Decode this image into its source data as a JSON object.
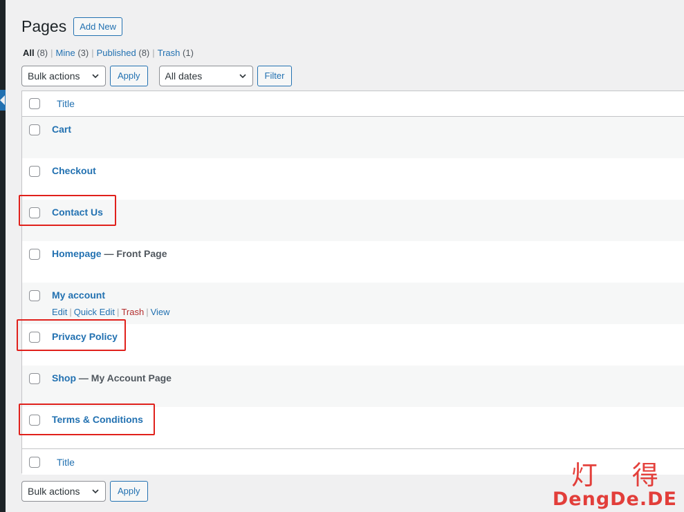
{
  "header": {
    "title": "Pages",
    "add_new_label": "Add New"
  },
  "views": [
    {
      "label": "All",
      "count": "(8)",
      "current": true
    },
    {
      "label": "Mine",
      "count": "(3)"
    },
    {
      "label": "Published",
      "count": "(8)"
    },
    {
      "label": "Trash",
      "count": "(1)"
    }
  ],
  "tablenav_top": {
    "bulk_actions": "Bulk actions",
    "apply_label": "Apply",
    "dates": "All dates",
    "filter_label": "Filter"
  },
  "tablenav_bottom": {
    "bulk_actions": "Bulk actions",
    "apply_label": "Apply"
  },
  "table": {
    "column_title": "Title",
    "rows": [
      {
        "title": "Cart",
        "state": ""
      },
      {
        "title": "Checkout",
        "state": ""
      },
      {
        "title": "Contact Us",
        "state": ""
      },
      {
        "title": "Homepage",
        "state": "— Front Page"
      },
      {
        "title": "My account",
        "state": "",
        "actions": [
          "Edit",
          "Quick Edit",
          "Trash",
          "View"
        ]
      },
      {
        "title": "Privacy Policy",
        "state": ""
      },
      {
        "title": "Shop",
        "state": "— My Account Page"
      },
      {
        "title": "Terms & Conditions",
        "state": ""
      }
    ]
  },
  "watermark": {
    "chars": "灯得",
    "text": "DengDe.DE"
  },
  "colors": {
    "accent": "#2271b1",
    "highlight": "#e0201b",
    "trash": "#b32d2e"
  }
}
